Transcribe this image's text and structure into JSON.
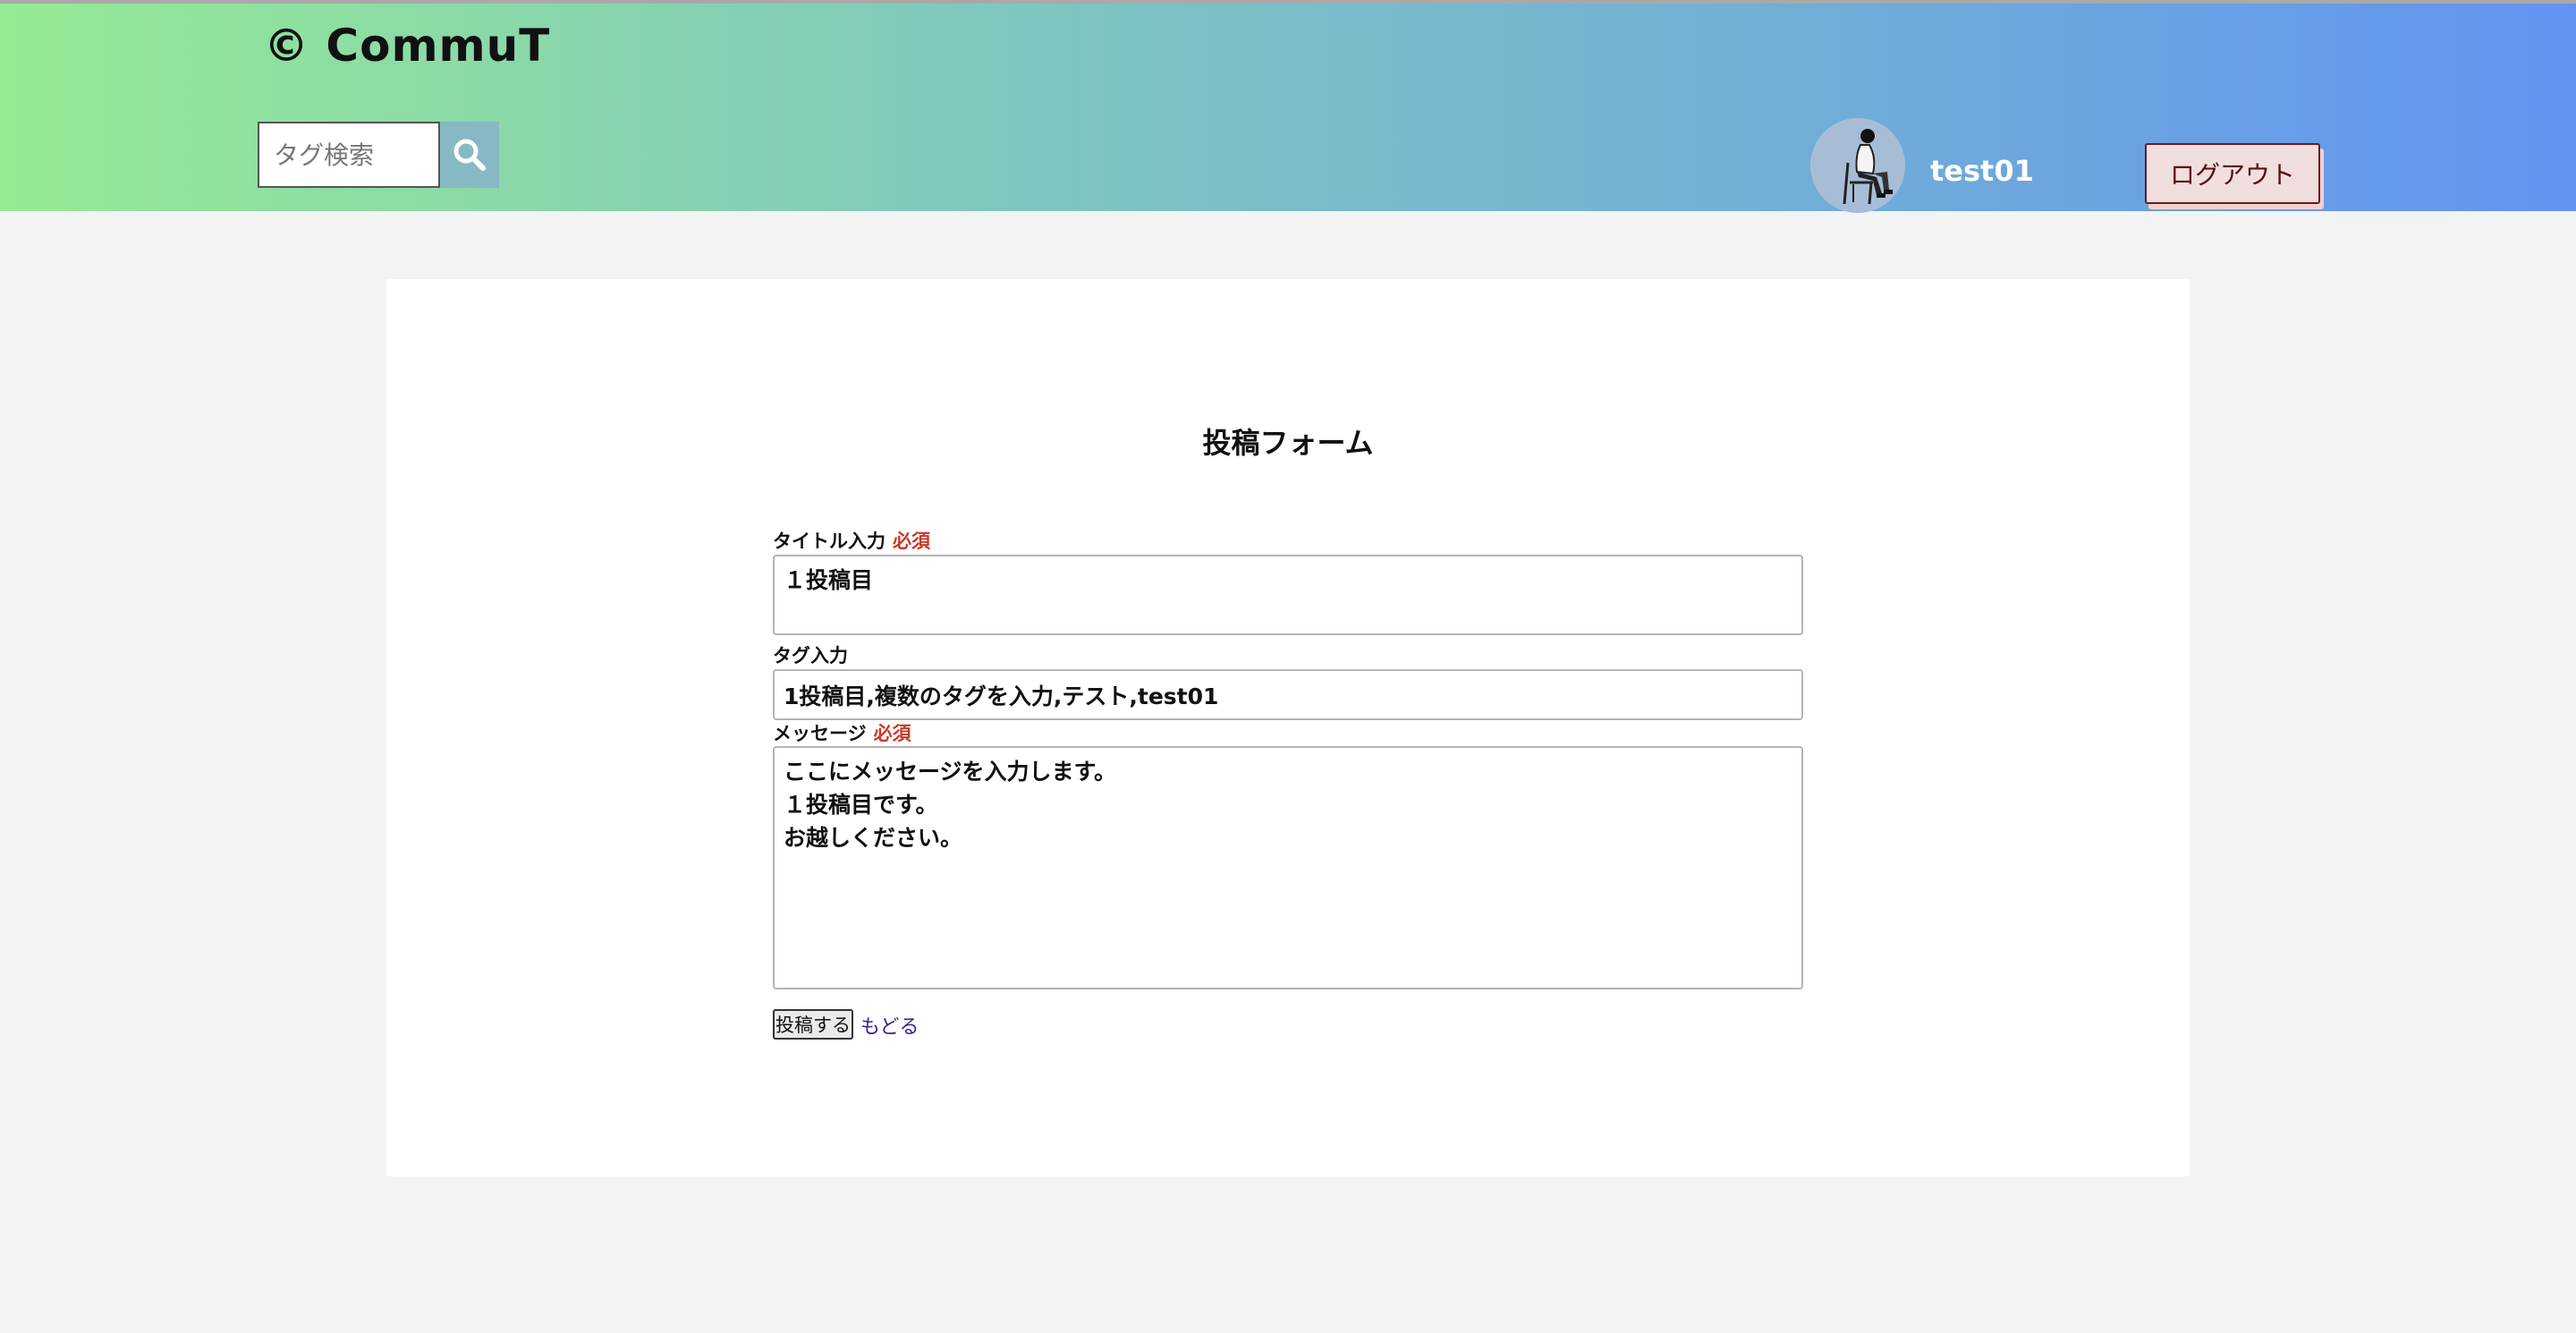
{
  "header": {
    "logo": "© CommuT",
    "search": {
      "placeholder": "タグ検索",
      "value": "",
      "button_icon": "search-icon"
    },
    "user": {
      "avatar_icon": "avatar-icon",
      "name": "test01"
    },
    "logout_label": "ログアウト"
  },
  "form": {
    "title": "投稿フォーム",
    "title_field": {
      "label": "タイトル入力",
      "required": "必須",
      "value": "１投稿目"
    },
    "tag_field": {
      "label": "タグ入力",
      "value": "1投稿目,複数のタグを入力,テスト,test01"
    },
    "message_field": {
      "label": "メッセージ",
      "required": "必須",
      "value": "ここにメッセージを入力します。\n１投稿目です。\nお越しください。"
    },
    "submit_label": "投稿する",
    "back_label": "もどる"
  },
  "colors": {
    "header_gradient_start": "#95ea94",
    "header_gradient_end": "#6393f2",
    "required": "#c8392a",
    "logout_bg": "#f1dede",
    "logout_border": "#6b1a1a",
    "search_button_bg": "#86b9c4",
    "page_bg": "#f2f3f3",
    "link": "#3b1f8f"
  }
}
